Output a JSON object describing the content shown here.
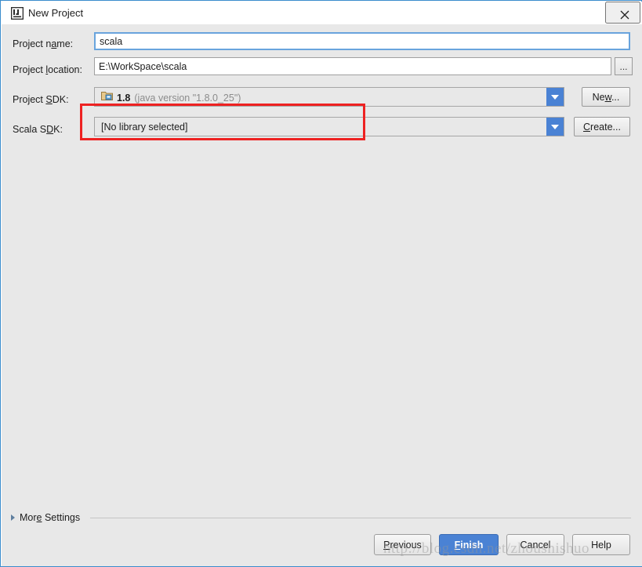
{
  "window": {
    "title": "New Project",
    "app_icon": "intellij-idea-icon",
    "close_icon": "close-icon",
    "accent_color": "#4a82d4",
    "background_color": "#e8e8e8",
    "annotation_color": "#ee2222"
  },
  "form": {
    "project_name": {
      "label": "Project name:",
      "label_pre": "Project n",
      "label_mnemonic": "a",
      "label_post": "me:",
      "value": "scala",
      "placeholder": ""
    },
    "project_location": {
      "label": "Project location:",
      "label_pre": "Project ",
      "label_mnemonic": "l",
      "label_post": "ocation:",
      "value": "E:\\WorkSpace\\scala",
      "placeholder": "",
      "browse_label": "...",
      "browse_icon": "ellipsis-icon"
    },
    "project_sdk": {
      "label": "Project SDK:",
      "label_pre": "Project ",
      "label_mnemonic": "S",
      "label_post": "DK:",
      "icon": "jdk-folder-icon",
      "version": "1.8",
      "detail": "(java version \"1.8.0_25\")",
      "dropdown_icon": "chevron-down-icon",
      "action_label": "New...",
      "action_pre": "Ne",
      "action_mnemonic": "w",
      "action_post": "..."
    },
    "scala_sdk": {
      "label": "Scala SDK:",
      "label_pre": "Scala S",
      "label_mnemonic": "D",
      "label_post": "K:",
      "value": "[No library selected]",
      "dropdown_icon": "chevron-down-icon",
      "action_label": "Create...",
      "action_pre": "",
      "action_mnemonic": "C",
      "action_post": "reate..."
    }
  },
  "more_settings": {
    "label": "More Settings",
    "label_pre": "Mor",
    "label_mnemonic": "e",
    "label_post": " Settings",
    "expander_icon": "triangle-right-icon",
    "expanded": false
  },
  "buttons": {
    "previous": {
      "label": "Previous",
      "pre": "",
      "mnemonic": "P",
      "post": "revious"
    },
    "finish": {
      "label": "Finish",
      "pre": "",
      "mnemonic": "F",
      "post": "inish",
      "default": true
    },
    "cancel": {
      "label": "Cancel",
      "pre": "Cancel",
      "mnemonic": "",
      "post": ""
    },
    "help": {
      "label": "Help",
      "pre": "Help",
      "mnemonic": "",
      "post": ""
    }
  },
  "watermark": {
    "text": "http://blog.csdn.net/zhoushishuo"
  }
}
